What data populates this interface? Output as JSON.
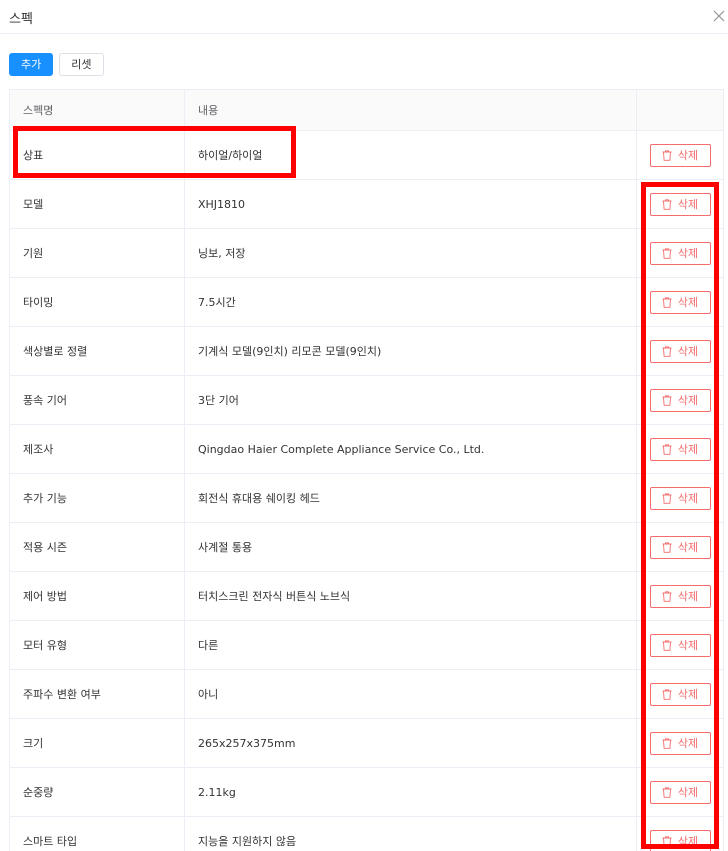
{
  "dialog": {
    "title": "스펙",
    "close_icon": "close-icon"
  },
  "toolbar": {
    "add_label": "추가",
    "reset_label": "리셋",
    "accent_color": "#1890ff"
  },
  "table": {
    "headers": [
      "스펙명",
      "내용",
      ""
    ],
    "delete_label": "삭제",
    "delete_icon": "trash-icon",
    "delete_color": "#f56c6c",
    "rows": [
      {
        "name": "상표",
        "value": "하이얼/하이얼"
      },
      {
        "name": "모델",
        "value": "XHJ1810"
      },
      {
        "name": "기원",
        "value": "닝보, 저장"
      },
      {
        "name": "타이밍",
        "value": "7.5시간"
      },
      {
        "name": "색상별로 정렬",
        "value": "기계식 모델(9인치) 리모콘 모델(9인치)"
      },
      {
        "name": "풍속 기어",
        "value": "3단 기어"
      },
      {
        "name": "제조사",
        "value": "Qingdao Haier Complete Appliance Service Co., Ltd."
      },
      {
        "name": "추가 기능",
        "value": "회전식 휴대용 쉐이킹 헤드"
      },
      {
        "name": "적용 시즌",
        "value": "사계절 통용"
      },
      {
        "name": "제어 방법",
        "value": "터치스크린 전자식 버튼식 노브식"
      },
      {
        "name": "모터 유형",
        "value": "다른"
      },
      {
        "name": "주파수 변환 여부",
        "value": "아니"
      },
      {
        "name": "크기",
        "value": "265x257x375mm"
      },
      {
        "name": "순중량",
        "value": "2.11kg"
      },
      {
        "name": "스마트 타입",
        "value": "지능을 지원하지 않음"
      }
    ]
  },
  "highlight_color": "#ff0000"
}
